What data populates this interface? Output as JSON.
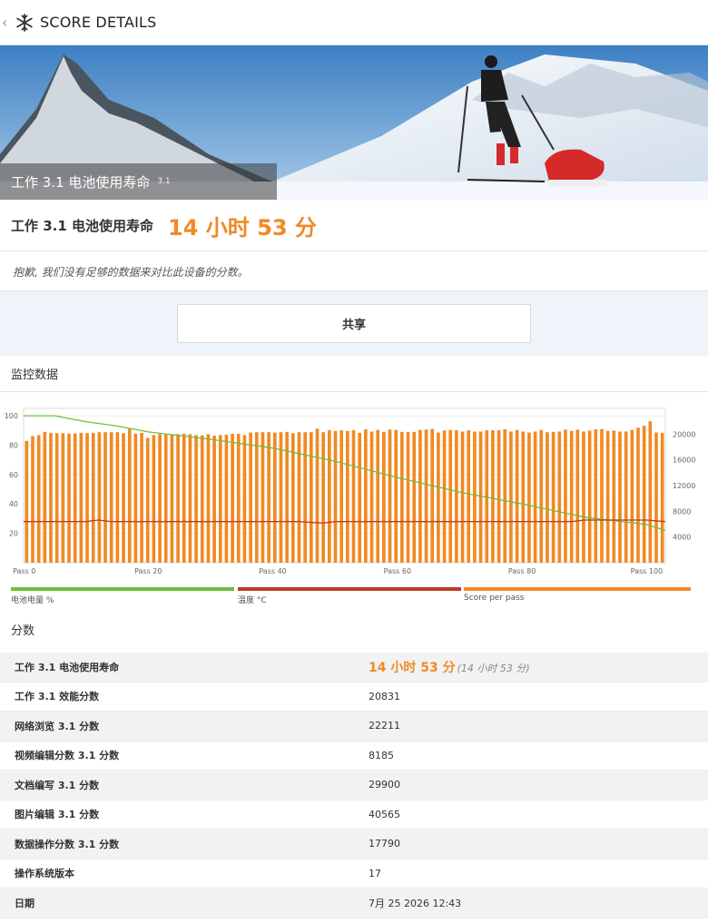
{
  "header": {
    "title": "SCORE DETAILS",
    "back_icon": "chevron-left-icon",
    "app_icon": "snowflake-icon"
  },
  "hero": {
    "label": "工作 3.1 电池使用寿命",
    "version": "3.1"
  },
  "result": {
    "name": "工作 3.1 电池使用寿命",
    "value": "14 小时 53 分",
    "note": "抱歉, 我们没有足够的数据来对比此设备的分数。"
  },
  "share_button": "共享",
  "monitor": {
    "title": "监控数据",
    "legend": [
      {
        "label": "电池电量 %",
        "color": "#6cbf3c"
      },
      {
        "label": "温度 °C",
        "color": "#c0392b"
      },
      {
        "label": "Score per pass",
        "color": "#f08a24"
      }
    ]
  },
  "chart_data": {
    "type": "bar",
    "x_tick_labels": [
      "Pass 0",
      "Pass 20",
      "Pass 40",
      "Pass 60",
      "Pass 80",
      "Pass 100"
    ],
    "x_tick_values": [
      0,
      20,
      40,
      60,
      80,
      100
    ],
    "left_axis": {
      "ticks": [
        20,
        40,
        60,
        80,
        100
      ],
      "ylim": [
        0,
        105
      ]
    },
    "right_axis": {
      "ticks": [
        4000,
        8000,
        12000,
        16000,
        20000
      ],
      "ylim": [
        0,
        24000
      ]
    },
    "score_per_pass": [
      18950,
      19700,
      19850,
      20350,
      20200,
      20150,
      20150,
      20050,
      20100,
      20200,
      20150,
      20200,
      20300,
      20300,
      20300,
      20300,
      20150,
      20800,
      20050,
      20200,
      19400,
      19850,
      20000,
      19900,
      19850,
      20000,
      20050,
      20000,
      19850,
      19800,
      20000,
      19750,
      19850,
      19900,
      20050,
      20050,
      19850,
      20250,
      20300,
      20300,
      20300,
      20250,
      20300,
      20350,
      20150,
      20300,
      20300,
      20300,
      20850,
      20300,
      20600,
      20500,
      20600,
      20500,
      20600,
      20200,
      20750,
      20400,
      20650,
      20350,
      20700,
      20650,
      20350,
      20300,
      20350,
      20650,
      20700,
      20800,
      20250,
      20550,
      20650,
      20600,
      20400,
      20600,
      20400,
      20400,
      20600,
      20600,
      20600,
      20750,
      20400,
      20650,
      20400,
      20250,
      20400,
      20650,
      20300,
      20350,
      20400,
      20700,
      20500,
      20700,
      20400,
      20550,
      20750,
      20800,
      20500,
      20550,
      20400,
      20400,
      20650,
      21000,
      21300,
      22000,
      20250,
      20200
    ],
    "battery_pct": [
      [
        0,
        100
      ],
      [
        5,
        100
      ],
      [
        10,
        96
      ],
      [
        15,
        93
      ],
      [
        20,
        89
      ],
      [
        30,
        84
      ],
      [
        40,
        78
      ],
      [
        50,
        69
      ],
      [
        60,
        58
      ],
      [
        70,
        48
      ],
      [
        80,
        40
      ],
      [
        90,
        31
      ],
      [
        100,
        26
      ],
      [
        103,
        22
      ]
    ],
    "temperature_c": [
      [
        0,
        28
      ],
      [
        10,
        28
      ],
      [
        12,
        29
      ],
      [
        14,
        28
      ],
      [
        30,
        28
      ],
      [
        44,
        28
      ],
      [
        48,
        27
      ],
      [
        50,
        28
      ],
      [
        75,
        28
      ],
      [
        80,
        28
      ],
      [
        88,
        28
      ],
      [
        90,
        29
      ],
      [
        100,
        29
      ],
      [
        103,
        28
      ]
    ]
  },
  "scores": {
    "title": "分数",
    "rows": [
      {
        "name": "工作 3.1 电池使用寿命",
        "value": "14 小时 53 分",
        "sub": "(14 小时 53 分)"
      },
      {
        "name": "工作 3.1 效能分数",
        "value": "20831"
      },
      {
        "name": "网络浏览 3.1 分数",
        "value": "22211"
      },
      {
        "name": "视频编辑分数 3.1 分数",
        "value": "8185"
      },
      {
        "name": "文档编写 3.1 分数",
        "value": "29900"
      },
      {
        "name": "图片编辑 3.1 分数",
        "value": "40565"
      },
      {
        "name": "数据操作分数 3.1 分数",
        "value": "17790"
      },
      {
        "name": "操作系统版本",
        "value": "17"
      },
      {
        "name": "日期",
        "value": "7月 25 2026 12:43"
      }
    ]
  }
}
